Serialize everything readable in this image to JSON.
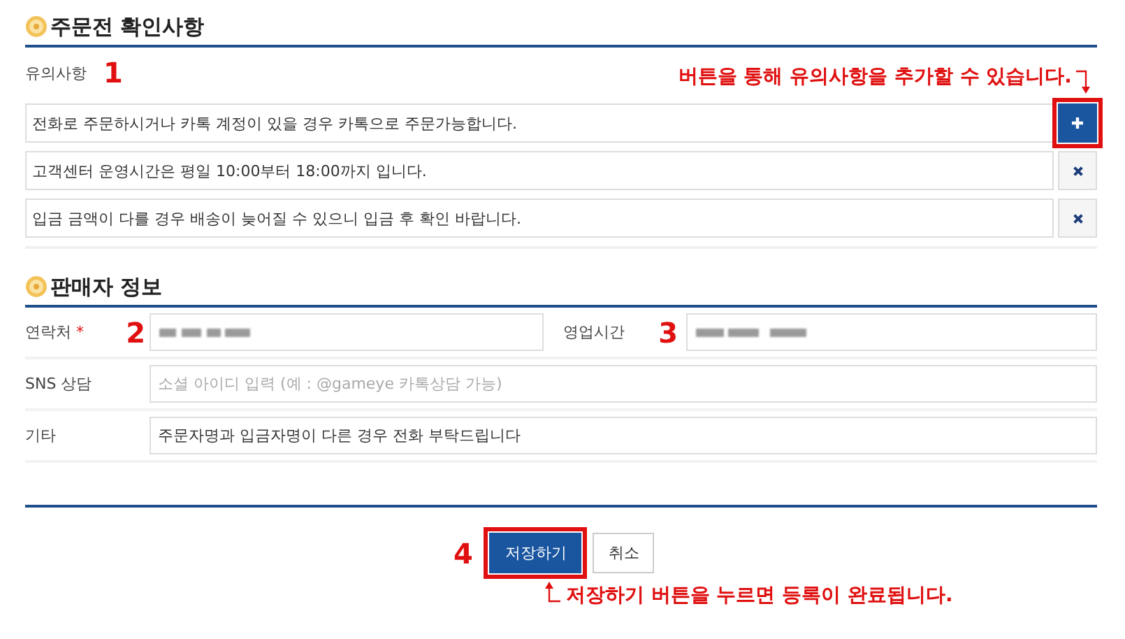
{
  "notice_section": {
    "title": "주문전 확인사항",
    "label": "유의사항",
    "marker": "1",
    "hint": "버튼을 통해 유의사항을 추가할 수 있습니다.",
    "notes": [
      {
        "text": "전화로 주문하시거나 카톡 계정이 있을 경우 카톡으로 주문가능합니다.",
        "kind": "add",
        "highlighted": true
      },
      {
        "text": "고객센터 운영시간은 평일 10:00부터 18:00까지 입니다.",
        "kind": "remove",
        "highlighted": false
      },
      {
        "text": "입금 금액이 다를 경우 배송이 늦어질 수 있으니 입금 후 확인 바랍니다.",
        "kind": "remove",
        "highlighted": false
      }
    ]
  },
  "seller_section": {
    "title": "판매자 정보",
    "contact": {
      "label": "연락처",
      "required_mark": "*",
      "marker": "2"
    },
    "hours": {
      "label": "영업시간",
      "marker": "3"
    },
    "sns": {
      "label": "SNS 상담",
      "placeholder": "소셜 아이디 입력 (예 : @gameye 카톡상담 가능)"
    },
    "other": {
      "label": "기타",
      "value": "주문자명과 입금자명이 다른 경우 전화 부탁드립니다"
    }
  },
  "footer": {
    "marker": "4",
    "hint": "저장하기 버튼을 누르면 등록이 완료됩니다.",
    "buttons": [
      {
        "label": "저장하기",
        "kind": "primary",
        "highlighted": true
      },
      {
        "label": "취소",
        "kind": "secondary",
        "highlighted": false
      }
    ]
  }
}
